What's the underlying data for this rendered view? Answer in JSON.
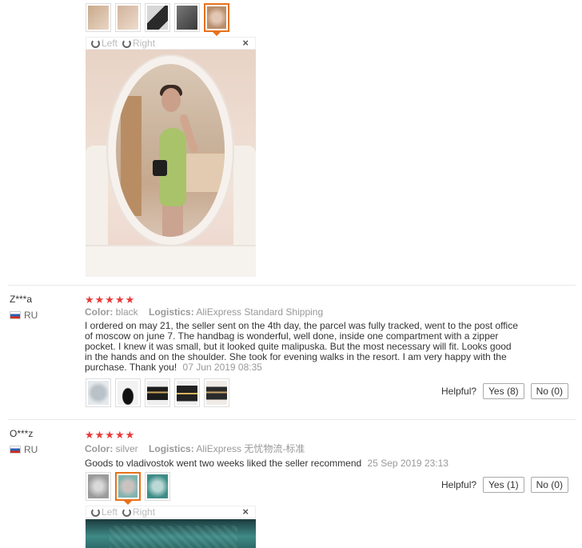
{
  "gallery_top": {
    "thumbs": [
      {
        "icon": "mirror-photo-thumb",
        "colors": [
          "#c9a98a",
          "#e8d6c4"
        ]
      },
      {
        "icon": "mirror-photo-thumb",
        "colors": [
          "#d2b29b",
          "#eddccd"
        ]
      },
      {
        "icon": "bag-photo-thumb",
        "colors": [
          "#2a2a2a",
          "#d7d7d7"
        ]
      },
      {
        "icon": "bag-photo-thumb",
        "colors": [
          "#3a3a3a",
          "#777"
        ]
      },
      {
        "icon": "mirror-photo-thumb",
        "colors": [
          "#b88e6c",
          "#e2c8b4"
        ],
        "active": true
      }
    ]
  },
  "viewer": {
    "rotate_left": "Left",
    "rotate_right": "Right",
    "close": "×"
  },
  "reviews": [
    {
      "user": "Z***a",
      "country": "RU",
      "stars": "★★★★★",
      "color_label": "Color:",
      "color_value": "black",
      "logistics_label": "Logistics:",
      "logistics_value": "AliExpress Standard Shipping",
      "text": "I ordered on may 21, the seller sent on the 4th day, the parcel was fully tracked, went to the post office of moscow on june 7. The handbag is wonderful, well done, inside one compartment with a zipper pocket. I knew it was small, but it looked quite malipuska. But the most necessary will fit. Looks good in the hands and on the shoulder. She took for evening walks in the resort. I am very happy with the purchase. Thank you!",
      "date": "07 Jun 2019 08:35",
      "helpful_label": "Helpful?",
      "yes_label": "Yes (8)",
      "no_label": "No (0)"
    },
    {
      "user": "O***z",
      "country": "RU",
      "stars": "★★★★★",
      "color_label": "Color:",
      "color_value": "silver",
      "logistics_label": "Logistics:",
      "logistics_value": "AliExpress 无忧物流-标准",
      "text": "Goods to vladivostok went two weeks liked the seller recommend",
      "date": "25 Sep 2019 23:13",
      "helpful_label": "Helpful?",
      "yes_label": "Yes (1)",
      "no_label": "No (0)"
    }
  ],
  "review1_thumbs": [
    {
      "icon": "bag-photo-thumb",
      "colors": [
        "#b9c2c8",
        "#e6e9ec"
      ]
    },
    {
      "icon": "bag-photo-thumb",
      "colors": [
        "#111",
        "#f2f2f2"
      ]
    },
    {
      "icon": "bag-photo-thumb",
      "colors": [
        "#1b1b1b",
        "#c9a65a"
      ]
    },
    {
      "icon": "bag-photo-thumb",
      "colors": [
        "#222",
        "#d4b45e"
      ]
    },
    {
      "icon": "bag-photo-thumb",
      "colors": [
        "#2a2a2a",
        "#caa26a"
      ]
    }
  ],
  "review2_thumbs": [
    {
      "icon": "bag-photo-thumb",
      "colors": [
        "#9a9a9a",
        "#d9d9d9"
      ]
    },
    {
      "icon": "bag-photo-thumb",
      "colors": [
        "#7fb3b0",
        "#c9c2bf"
      ],
      "active": true
    },
    {
      "icon": "bag-photo-thumb",
      "colors": [
        "#3d8c86",
        "#b9d8d6"
      ]
    }
  ]
}
